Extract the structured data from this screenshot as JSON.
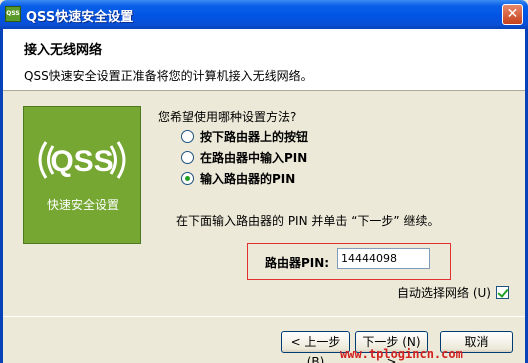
{
  "window": {
    "app_icon_text": "QSS",
    "title": "QSS快速安全设置",
    "close_glyph": "✕"
  },
  "header": {
    "title": "接入无线网络",
    "description": "QSS快速安全设置正准备将您的计算机接入无线网络。"
  },
  "qss_panel": {
    "logo_text": "QSS",
    "caption": "快速安全设置"
  },
  "method": {
    "question": "您希望使用哪种设置方法?",
    "options": [
      {
        "label": "按下路由器上的按钮",
        "checked": false
      },
      {
        "label": "在路由器中输入PIN",
        "checked": false
      },
      {
        "label": "输入路由器的PIN",
        "checked": true
      }
    ]
  },
  "instruction": "在下面输入路由器的 PIN 并单击 “下一步” 继续。",
  "pin": {
    "label": "路由器PIN:",
    "value": "14444098"
  },
  "auto_select": {
    "label": "自动选择网络 (U)",
    "checked": true
  },
  "buttons": {
    "back": "< 上一步 (B)",
    "next": "下一步 (N) >",
    "cancel": "取消"
  },
  "watermark": "www.tplogincn.com",
  "colors": {
    "titlebar": "#0054e3",
    "qss_green": "#75a732",
    "pin_highlight": "#e03030",
    "dialog_bg": "#ECE9D8"
  }
}
